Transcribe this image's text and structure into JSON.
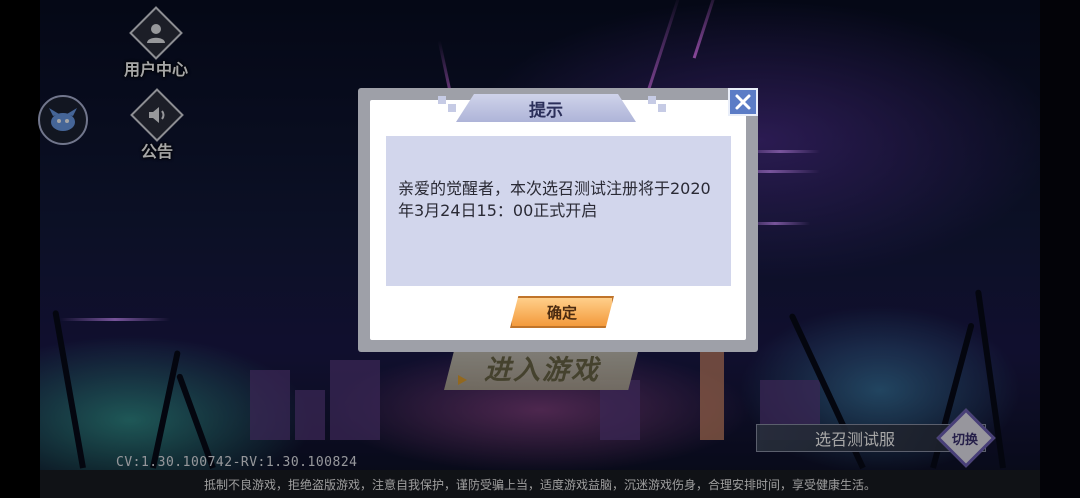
{
  "side_menu": {
    "user_center_label": "用户中心",
    "notice_label": "公告"
  },
  "enter_game_label": "进入游戏",
  "server": {
    "name": "选召测试服",
    "switch_label": "切换"
  },
  "version_text": "CV:1.30.100742-RV:1.30.100824",
  "bottom_notice": "抵制不良游戏，拒绝盗版游戏，注意自我保护，谨防受骗上当，适度游戏益脑，沉迷游戏伤身，合理安排时间，享受健康生活。",
  "dialog": {
    "title": "提示",
    "message": "亲爱的觉醒者，本次选召测试注册将于2020年3月24日15：00正式开启",
    "confirm_label": "确定"
  },
  "icons": [
    "user-icon",
    "speaker-icon",
    "avatar-icon",
    "close-icon",
    "play-arrow-icon",
    "switch-diamond-icon"
  ],
  "colors": {
    "dialog_title_bg": "#aeb4d8",
    "message_bg": "#d2d6ec",
    "confirm_button": "#f39a3c",
    "close_button": "#5b7cc6"
  }
}
